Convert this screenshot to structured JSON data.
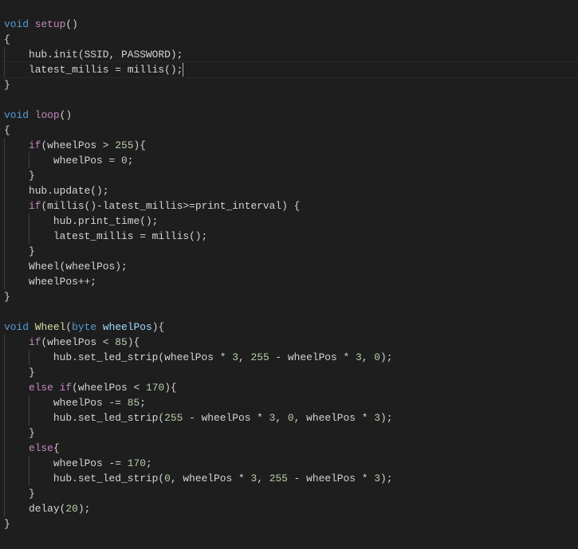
{
  "editor": {
    "cursor_line": 4,
    "lines": [
      {
        "indent": 0,
        "tokens": [
          [
            "{",
            "brace"
          ]
        ]
      },
      {
        "indent": 0,
        "tokens": []
      },
      {
        "indent": 0,
        "tokens": [
          [
            "void",
            "kw"
          ],
          [
            " ",
            ""
          ],
          [
            "setup",
            "decl"
          ],
          [
            "()",
            ""
          ]
        ]
      },
      {
        "indent": 0,
        "tokens": [
          [
            "{",
            "brace"
          ]
        ]
      },
      {
        "indent": 1,
        "tokens": [
          [
            "hub.init(SSID, PASSWORD);",
            ""
          ]
        ]
      },
      {
        "indent": 1,
        "tokens": [
          [
            "latest_millis = millis();",
            ""
          ]
        ]
      },
      {
        "indent": 0,
        "tokens": [
          [
            "}",
            "brace"
          ]
        ]
      },
      {
        "indent": 0,
        "tokens": []
      },
      {
        "indent": 0,
        "tokens": [
          [
            "void",
            "kw"
          ],
          [
            " ",
            ""
          ],
          [
            "loop",
            "decl"
          ],
          [
            "()",
            ""
          ]
        ]
      },
      {
        "indent": 0,
        "tokens": [
          [
            "{",
            "brace"
          ]
        ]
      },
      {
        "indent": 1,
        "tokens": [
          [
            "if",
            "ctrl"
          ],
          [
            "(wheelPos > ",
            ""
          ],
          [
            "255",
            "num"
          ],
          [
            "){",
            ""
          ]
        ]
      },
      {
        "indent": 2,
        "tokens": [
          [
            "wheelPos = ",
            ""
          ],
          [
            "0",
            "num"
          ],
          [
            ";",
            ""
          ]
        ]
      },
      {
        "indent": 1,
        "tokens": [
          [
            "}",
            ""
          ]
        ]
      },
      {
        "indent": 1,
        "tokens": [
          [
            "hub.update();",
            ""
          ]
        ]
      },
      {
        "indent": 1,
        "tokens": [
          [
            "if",
            "ctrl"
          ],
          [
            "(millis()-latest_millis>=print_interval) {",
            ""
          ]
        ]
      },
      {
        "indent": 2,
        "tokens": [
          [
            "hub.print_time();",
            ""
          ]
        ]
      },
      {
        "indent": 2,
        "tokens": [
          [
            "latest_millis = millis();",
            ""
          ]
        ]
      },
      {
        "indent": 1,
        "tokens": [
          [
            "}",
            ""
          ]
        ]
      },
      {
        "indent": 1,
        "tokens": [
          [
            "Wheel(wheelPos);",
            ""
          ]
        ]
      },
      {
        "indent": 1,
        "tokens": [
          [
            "wheelPos++;",
            ""
          ]
        ]
      },
      {
        "indent": 0,
        "tokens": [
          [
            "}",
            "brace"
          ]
        ]
      },
      {
        "indent": 0,
        "tokens": []
      },
      {
        "indent": 0,
        "tokens": [
          [
            "void",
            "kw"
          ],
          [
            " ",
            ""
          ],
          [
            "Wheel",
            "fn"
          ],
          [
            "(",
            ""
          ],
          [
            "byte",
            "kw"
          ],
          [
            " ",
            ""
          ],
          [
            "wheelPos",
            "param"
          ],
          [
            "){",
            ""
          ]
        ]
      },
      {
        "indent": 1,
        "tokens": [
          [
            "if",
            "ctrl"
          ],
          [
            "(wheelPos < ",
            ""
          ],
          [
            "85",
            "num"
          ],
          [
            "){",
            ""
          ]
        ]
      },
      {
        "indent": 2,
        "tokens": [
          [
            "hub.set_led_strip(wheelPos * ",
            ""
          ],
          [
            "3",
            "num"
          ],
          [
            ", ",
            ""
          ],
          [
            "255",
            "num"
          ],
          [
            " - wheelPos * ",
            ""
          ],
          [
            "3",
            "num"
          ],
          [
            ", ",
            ""
          ],
          [
            "0",
            "num"
          ],
          [
            ");",
            ""
          ]
        ]
      },
      {
        "indent": 1,
        "tokens": [
          [
            "}",
            ""
          ]
        ]
      },
      {
        "indent": 1,
        "tokens": [
          [
            "else",
            "ctrl"
          ],
          [
            " ",
            ""
          ],
          [
            "if",
            "ctrl"
          ],
          [
            "(wheelPos < ",
            ""
          ],
          [
            "170",
            "num"
          ],
          [
            "){",
            ""
          ]
        ]
      },
      {
        "indent": 2,
        "tokens": [
          [
            "wheelPos -= ",
            ""
          ],
          [
            "85",
            "num"
          ],
          [
            ";",
            ""
          ]
        ]
      },
      {
        "indent": 2,
        "tokens": [
          [
            "hub.set_led_strip(",
            ""
          ],
          [
            "255",
            "num"
          ],
          [
            " - wheelPos * ",
            ""
          ],
          [
            "3",
            "num"
          ],
          [
            ", ",
            ""
          ],
          [
            "0",
            "num"
          ],
          [
            ", wheelPos * ",
            ""
          ],
          [
            "3",
            "num"
          ],
          [
            ");",
            ""
          ]
        ]
      },
      {
        "indent": 1,
        "tokens": [
          [
            "}",
            ""
          ]
        ]
      },
      {
        "indent": 1,
        "tokens": [
          [
            "else",
            "ctrl"
          ],
          [
            "{",
            ""
          ]
        ]
      },
      {
        "indent": 2,
        "tokens": [
          [
            "wheelPos -= ",
            ""
          ],
          [
            "170",
            "num"
          ],
          [
            ";",
            ""
          ]
        ]
      },
      {
        "indent": 2,
        "tokens": [
          [
            "hub.set_led_strip(",
            ""
          ],
          [
            "0",
            "num"
          ],
          [
            ", wheelPos * ",
            ""
          ],
          [
            "3",
            "num"
          ],
          [
            ", ",
            ""
          ],
          [
            "255",
            "num"
          ],
          [
            " - wheelPos * ",
            ""
          ],
          [
            "3",
            "num"
          ],
          [
            ");",
            ""
          ]
        ]
      },
      {
        "indent": 1,
        "tokens": [
          [
            "}",
            ""
          ]
        ]
      },
      {
        "indent": 1,
        "tokens": [
          [
            "delay(",
            ""
          ],
          [
            "20",
            "num"
          ],
          [
            ");",
            ""
          ]
        ]
      },
      {
        "indent": 0,
        "tokens": [
          [
            "}",
            "brace"
          ]
        ]
      }
    ]
  }
}
